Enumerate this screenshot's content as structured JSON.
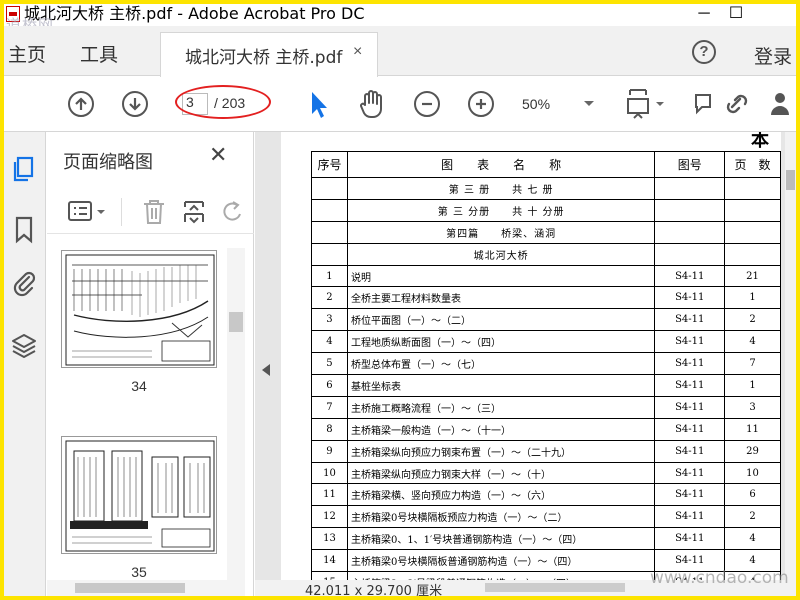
{
  "window": {
    "title": "城北河大桥 主桥.pdf - Adobe Acrobat Pro DC",
    "watermark_top": "道桥网",
    "minimize": "─",
    "maximize": "☐"
  },
  "menubar": {
    "home": "主页",
    "tools": "工具",
    "doc_tab": "城北河大桥 主桥.pdf",
    "doc_tab_close": "×",
    "help": "?",
    "login": "登录"
  },
  "toolbar": {
    "page_current": "3",
    "page_total": "/ 203",
    "zoom": "50%"
  },
  "thumb_panel": {
    "title": "页面缩略图",
    "close": "✕",
    "thumbs": [
      {
        "number": "34"
      },
      {
        "number": "35"
      }
    ]
  },
  "document": {
    "head_glyph": "本",
    "header": {
      "num": "序号",
      "title": "图　　表　　名　　称",
      "code": "图号",
      "pages": "页　数"
    },
    "span_rows": [
      "第 三 册　　共 七 册",
      "第 三 分册　　共 十 分册",
      "第四篇　　桥梁、涵洞",
      "城北河大桥"
    ],
    "rows": [
      {
        "num": "1",
        "title": "说明",
        "code": "S4-11",
        "pages": "21"
      },
      {
        "num": "2",
        "title": "全桥主要工程材料数量表",
        "code": "S4-11",
        "pages": "1"
      },
      {
        "num": "3",
        "title": "桥位平面图（一）～（二）",
        "code": "S4-11",
        "pages": "2"
      },
      {
        "num": "4",
        "title": "工程地质纵断面图（一）～（四）",
        "code": "S4-11",
        "pages": "4"
      },
      {
        "num": "5",
        "title": "桥型总体布置（一）～（七）",
        "code": "S4-11",
        "pages": "7"
      },
      {
        "num": "6",
        "title": "基桩坐标表",
        "code": "S4-11",
        "pages": "1"
      },
      {
        "num": "7",
        "title": "主桥施工概略流程（一）～（三）",
        "code": "S4-11",
        "pages": "3"
      },
      {
        "num": "8",
        "title": "主桥箱梁一般构造（一）～（十一）",
        "code": "S4-11",
        "pages": "11"
      },
      {
        "num": "9",
        "title": "主桥箱梁纵向预应力钢束布置（一）～（二十九）",
        "code": "S4-11",
        "pages": "29"
      },
      {
        "num": "10",
        "title": "主桥箱梁纵向预应力钢束大样（一）～（十）",
        "code": "S4-11",
        "pages": "10"
      },
      {
        "num": "11",
        "title": "主桥箱梁横、竖向预应力构造（一）～（六）",
        "code": "S4-11",
        "pages": "6"
      },
      {
        "num": "12",
        "title": "主桥箱梁0号块横隔板预应力构造（一）～（二）",
        "code": "S4-11",
        "pages": "2"
      },
      {
        "num": "13",
        "title": "主桥箱梁0、1、1′号块普通钢筋构造（一）～（四）",
        "code": "S4-11",
        "pages": "4"
      },
      {
        "num": "14",
        "title": "主桥箱梁0号块横隔板普通钢筋构造（一）～（四）",
        "code": "S4-11",
        "pages": "4"
      },
      {
        "num": "15",
        "title": "主桥箱梁2、2′号梁段普通钢筋构造（一）～（四）",
        "code": "S4-11",
        "pages": "4"
      }
    ],
    "dimensions": "42.011 x 29.700 厘米"
  },
  "watermark_bottom": "www.cndao.com",
  "colors": {
    "accent": "#1473e6",
    "highlight_ellipse": "#e32020",
    "frame": "#fde400"
  }
}
